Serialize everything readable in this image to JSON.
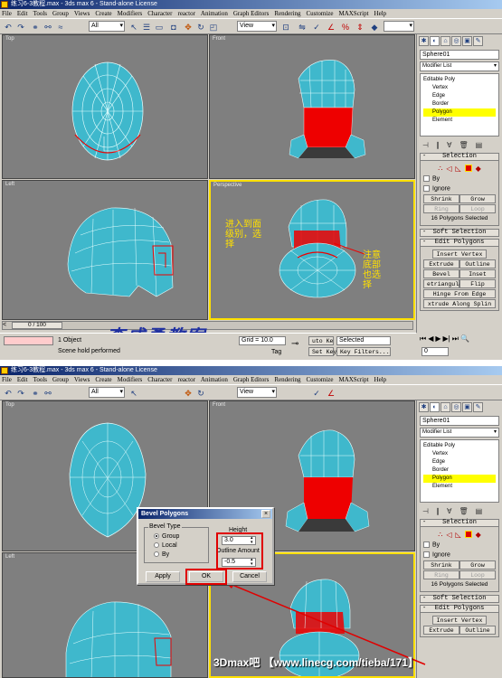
{
  "screenshot1": {
    "title": "练习6-3教程.max - 3ds max 6 - Stand-alone License",
    "menu": [
      "File",
      "Edit",
      "Tools",
      "Group",
      "Views",
      "Create",
      "Modifiers",
      "Character",
      "reactor",
      "Animation",
      "Graph Editors",
      "Rendering",
      "Customize",
      "MAXScript",
      "Help"
    ],
    "selection_filter": "All",
    "ref_coord": "View",
    "viewports": {
      "top": "Top",
      "front": "Front",
      "left": "Left",
      "perspective": "Perspective"
    },
    "object_name": "Sphere01",
    "modifier_list": "Modifier List",
    "stack": {
      "root": "Editable Poly",
      "items": [
        "Vertex",
        "Edge",
        "Border",
        "Polygon",
        "Element"
      ],
      "selected": "Polygon"
    },
    "selection_rollout": {
      "title": "Selection",
      "by_vertex": "By",
      "ignore": "Ignore",
      "shrink": "Shrink",
      "grow": "Grow",
      "ring": "Ring",
      "loop": "Loop",
      "status": "16 Polygons Selected"
    },
    "soft_selection": "Soft Selection",
    "edit_polygons": {
      "title": "Edit Polygons",
      "insert_vertex": "Insert Vertex",
      "extrude": "Extrude",
      "outline": "Outline",
      "bevel": "Bevel",
      "inset": "Inset",
      "retriangulate": "etriangula",
      "flip": "Flip",
      "hinge": "Hinge From Edge",
      "extrude_along": "xtrude Along Splin"
    },
    "annotation_cn1": "进入到面\n级别，选\n择",
    "annotation_cn2": "注意\n底部\n也选\n择",
    "time_slider": "0 / 100",
    "status_objects": "1 Object",
    "status_prompt": "Scene hold performed",
    "grid": "Grid = 10.0",
    "auto_key": "uto Ke",
    "selected": "Selected",
    "set_key": "Set Key",
    "key_filters": "Key Filters...",
    "add_time_tag": "Tag",
    "frame": "0",
    "watermark": "李成勇教案"
  },
  "screenshot2": {
    "title": "练习6-3教程.max - 3ds max 6 - Stand-alone License",
    "object_name": "Sphere01",
    "modifier_list": "Modifier List",
    "dialog": {
      "title": "Bevel Polygons",
      "bevel_type_label": "Bevel Type",
      "options": [
        "Group",
        "Local",
        "By"
      ],
      "selected_option": "Group",
      "height_label": "Height",
      "height_value": "3.0",
      "outline_label": "Outline Amount",
      "outline_value": "-0.5",
      "apply": "Apply",
      "ok": "OK",
      "cancel": "Cancel"
    },
    "footer_watermark": "3Dmax吧 【www.linecg.com/tieba/171】"
  },
  "colors": {
    "viewport_bg": "#7f7f7f",
    "mesh": "#3fb8cc",
    "selected_poly": "#ee0000",
    "active_border": "#ffe000",
    "annotation": "#ffe000",
    "watermark": "#2030a0"
  }
}
